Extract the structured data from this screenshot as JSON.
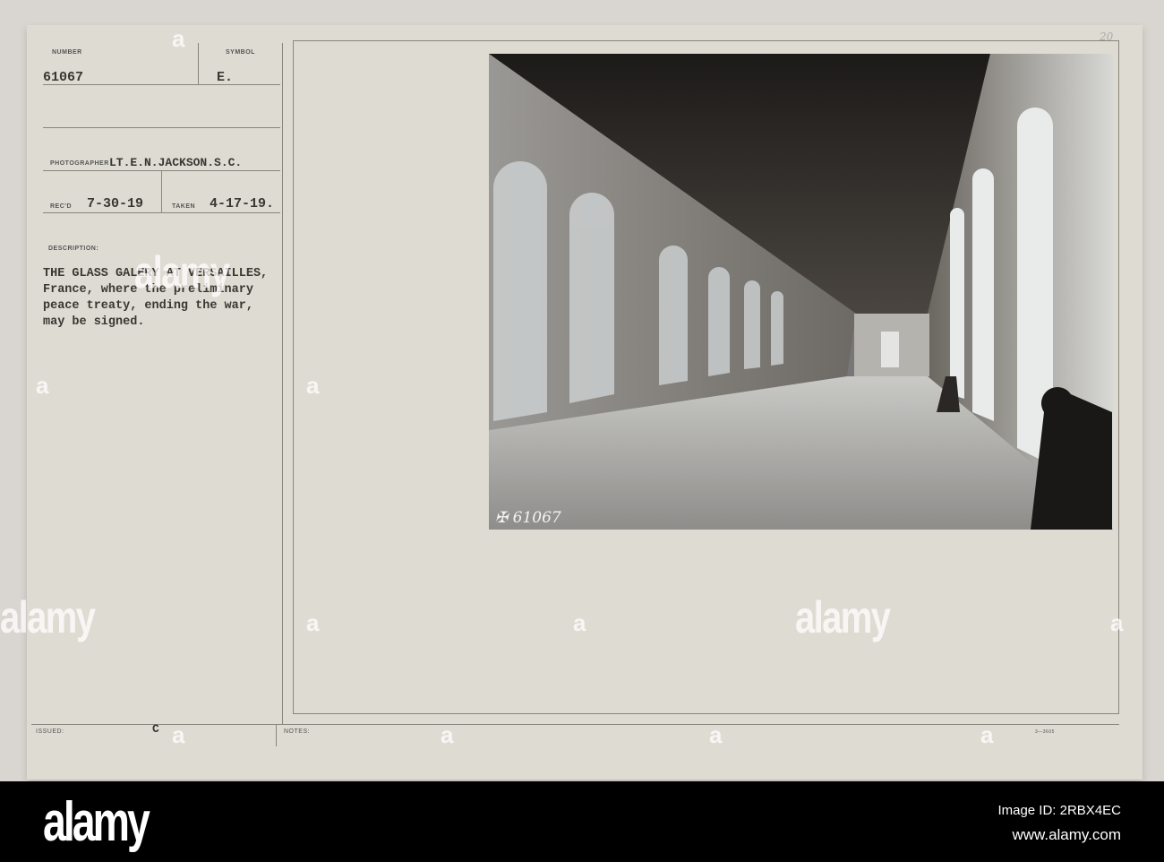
{
  "record": {
    "number_label": "NUMBER",
    "number": "61067",
    "symbol_label": "SYMBOL",
    "symbol": "E.",
    "photographer_label": "PHOTOGRAPHER",
    "photographer": "LT.E.N.JACKSON.S.C.",
    "recd_label": "REC'D",
    "recd": "7-30-19",
    "taken_label": "TAKEN",
    "taken": "4-17-19.",
    "description_label": "DESCRIPTION:",
    "description_lines": [
      "THE GLASS GALERY AT VERSAILLES,",
      "France, where the preliminary",
      "peace treaty, ending the war,",
      "may be signed."
    ],
    "issued_label": "ISSUED:",
    "issued": "C",
    "notes_label": "NOTES:",
    "form_code": "3—3605",
    "corner_mark": "20"
  },
  "photo": {
    "negative_number": "61067"
  },
  "watermark": {
    "text": "alamy",
    "letter": "a"
  },
  "footer": {
    "logo": "alamy",
    "image_id": "Image ID: 2RBX4EC",
    "url": "www.alamy.com"
  }
}
